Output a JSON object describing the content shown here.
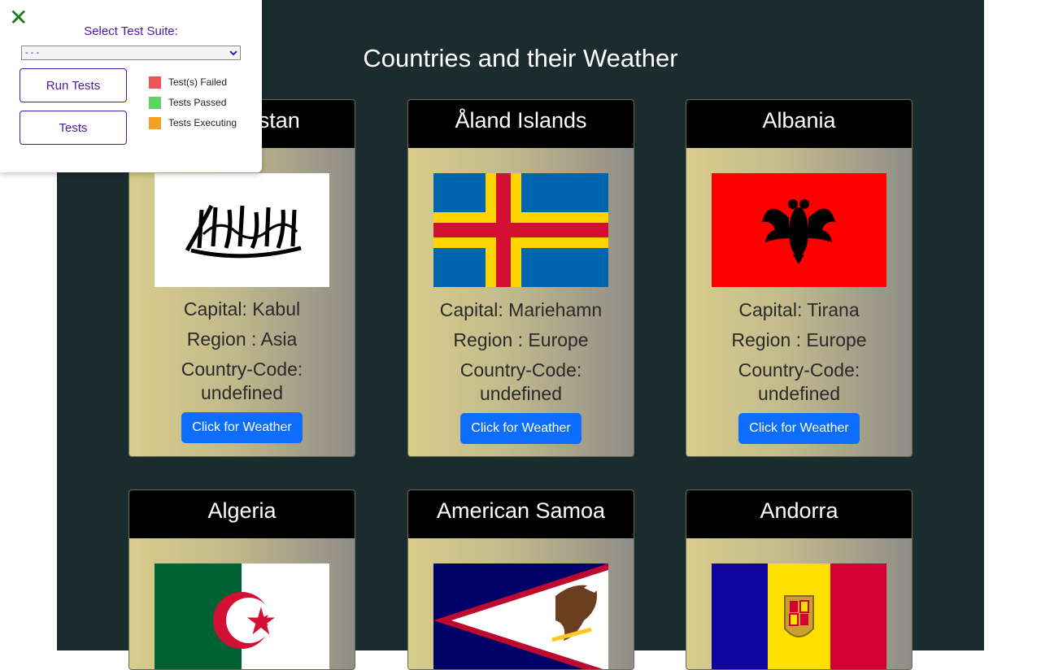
{
  "page": {
    "title": "Countries and their Weather"
  },
  "colors": {
    "background": "#1b2b2e",
    "header": "#000000",
    "button": "#0d6efd",
    "panel_accent": "#4b1aa8",
    "close_icon": "#1a7a1a"
  },
  "test_panel": {
    "close_icon": "close-icon",
    "suite_label": "Select Test Suite:",
    "suite_selected": "- - -",
    "run_button": "Run Tests",
    "tests_button": "Tests",
    "legend": [
      {
        "label": "Test(s) Failed",
        "color": "#f05454"
      },
      {
        "label": "Tests Passed",
        "color": "#5ed35e"
      },
      {
        "label": "Tests Executing",
        "color": "#f5a023"
      }
    ]
  },
  "cards": [
    {
      "name": "Afghanistan",
      "name_visible": "stan",
      "capital": "Capital: Kabul",
      "region": "Region : Asia",
      "code_label": "Country-Code:",
      "code_value": "undefined",
      "button": "Click for Weather",
      "flag_icon": "afghanistan-flag-icon"
    },
    {
      "name": "Åland Islands",
      "capital": "Capital: Mariehamn",
      "region": "Region : Europe",
      "code_label": "Country-Code:",
      "code_value": "undefined",
      "button": "Click for Weather",
      "flag_icon": "aland-flag-icon"
    },
    {
      "name": "Albania",
      "capital": "Capital: Tirana",
      "region": "Region : Europe",
      "code_label": "Country-Code:",
      "code_value": "undefined",
      "button": "Click for Weather",
      "flag_icon": "albania-flag-icon"
    },
    {
      "name": "Algeria",
      "flag_icon": "algeria-flag-icon"
    },
    {
      "name": "American Samoa",
      "flag_icon": "american-samoa-flag-icon"
    },
    {
      "name": "Andorra",
      "flag_icon": "andorra-flag-icon"
    }
  ]
}
